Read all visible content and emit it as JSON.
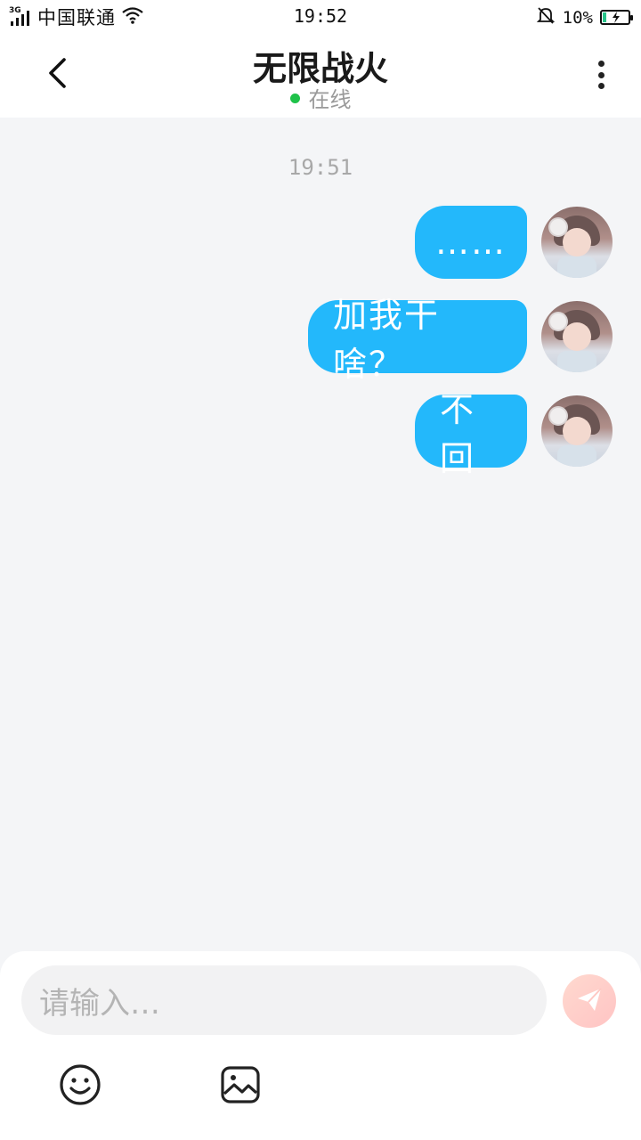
{
  "status_bar": {
    "network_tag": "3G",
    "carrier": "中国联通",
    "time": "19:52",
    "battery": "10%"
  },
  "header": {
    "title": "无限战火",
    "status": "在线"
  },
  "chat": {
    "timestamp": "19:51",
    "messages": [
      {
        "text": "……",
        "sender": "self"
      },
      {
        "text": "加我干啥？",
        "sender": "self"
      },
      {
        "text": "不回",
        "sender": "self"
      }
    ]
  },
  "input": {
    "placeholder": "请输入…"
  },
  "colors": {
    "bubble": "#23b8fb",
    "online_dot": "#1fc24a",
    "send_button": "#ffc9c4",
    "battery_fill": "#28c48a"
  },
  "icons": {
    "back": "chevron-left-icon",
    "more": "more-vertical-icon",
    "send": "paper-plane-icon",
    "emoji": "smiley-icon",
    "image": "image-icon",
    "wifi": "wifi-icon",
    "mute": "bell-off-icon"
  }
}
